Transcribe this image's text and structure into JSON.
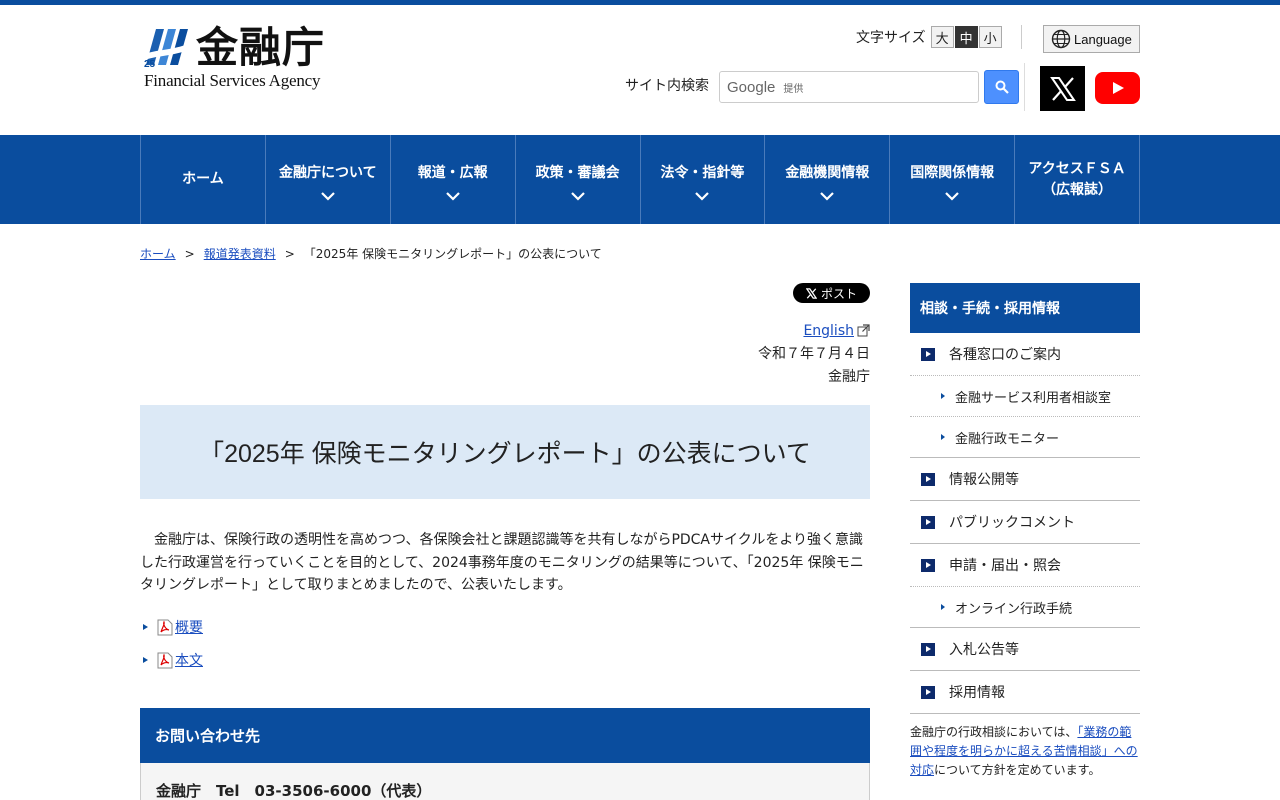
{
  "header": {
    "logo_kanji": "金融庁",
    "logo_en": "Financial Services Agency",
    "font_size_label": "文字サイズ",
    "font_sizes": [
      "大",
      "中",
      "小"
    ],
    "font_size_active": "中",
    "language_label": "Language",
    "search_label": "サイト内検索",
    "search_google": "Google",
    "search_provided": "提供"
  },
  "nav": {
    "items": [
      {
        "label": "ホーム",
        "chevron": false
      },
      {
        "label": "金融庁について",
        "chevron": true
      },
      {
        "label": "報道・広報",
        "chevron": true
      },
      {
        "label": "政策・審議会",
        "chevron": true
      },
      {
        "label": "法令・指針等",
        "chevron": true
      },
      {
        "label": "金融機関情報",
        "chevron": true
      },
      {
        "label": "国際関係情報",
        "chevron": true
      },
      {
        "label": "アクセスＦＳＡ",
        "label2": "（広報誌）",
        "chevron": false
      }
    ]
  },
  "breadcrumb": {
    "home": "ホーム",
    "sep": ">",
    "press": "報道発表資料",
    "current": "「2025年 保険モニタリングレポート」の公表について"
  },
  "main": {
    "share_label": "ポスト",
    "english_link": "English",
    "date": "令和７年７月４日",
    "org": "金融庁",
    "title": "「2025年 保険モニタリングレポート」の公表について",
    "body": "金融庁は、保険行政の透明性を高めつつ、各保険会社と課題認識等を共有しながらPDCAサイクルをより強く意識した行政運営を行っていくことを目的として、2024事務年度のモニタリングの結果等について、「2025年 保険モニタリングレポート」として取りまとめましたので、公表いたします。",
    "links": [
      {
        "label": "概要"
      },
      {
        "label": "本文"
      }
    ],
    "contact_heading": "お問い合わせ先",
    "contact_body": "金融庁　Tel　03-3506-6000（代表）"
  },
  "sidebar": {
    "heading": "相談・手続・採用情報",
    "items": [
      {
        "label": "各種窓口のご案内",
        "level": 1,
        "dotted": true
      },
      {
        "label": "金融サービス利用者相談室",
        "level": 2,
        "dotted": true
      },
      {
        "label": "金融行政モニター",
        "level": 2,
        "dotted": false
      },
      {
        "label": "情報公開等",
        "level": 1,
        "dotted": false
      },
      {
        "label": "パブリックコメント",
        "level": 1,
        "dotted": false
      },
      {
        "label": "申請・届出・照会",
        "level": 1,
        "dotted": true
      },
      {
        "label": "オンライン行政手続",
        "level": 2,
        "dotted": false
      },
      {
        "label": "入札公告等",
        "level": 1,
        "dotted": false
      },
      {
        "label": "採用情報",
        "level": 1,
        "dotted": false
      }
    ],
    "note_pre": "金融庁の行政相談においては、",
    "note_link": "「業務の範囲や程度を明らかに超える苦情相談」への対応",
    "note_post": "について方針を定めています。"
  },
  "colors": {
    "brand": "#0a4d9e",
    "title_bg": "#dce9f6",
    "link": "#1a4dbf"
  }
}
